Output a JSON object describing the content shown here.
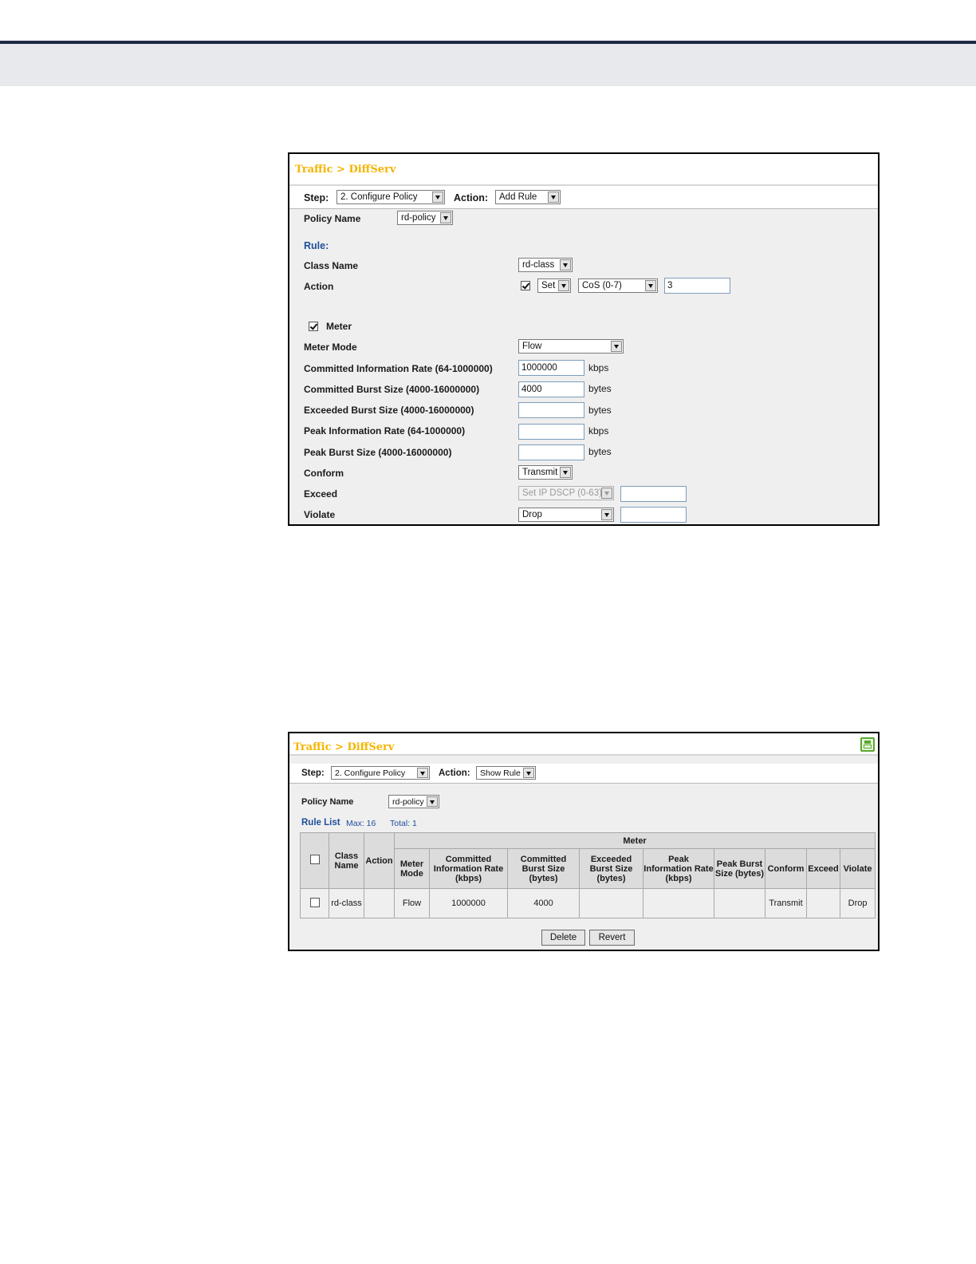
{
  "panel1": {
    "title": "Traffic > DiffServ",
    "step_label": "Step:",
    "step_value": "2. Configure Policy",
    "action_label": "Action:",
    "action_value": "Add Rule",
    "policy_name_label": "Policy Name",
    "policy_name_value": "rd-policy",
    "rule_heading": "Rule:",
    "class_name_label": "Class Name",
    "class_name_value": "rd-class",
    "action_row_label": "Action",
    "action_set_value": "Set",
    "action_type_value": "CoS (0-7)",
    "action_input_value": "3",
    "meter_label": "Meter",
    "meter_mode_label": "Meter Mode",
    "meter_mode_value": "Flow",
    "cir_label": "Committed Information Rate (64-1000000)",
    "cir_value": "1000000",
    "cir_unit": "kbps",
    "cbs_label": "Committed Burst Size (4000-16000000)",
    "cbs_value": "4000",
    "cbs_unit": "bytes",
    "ebs_label": "Exceeded Burst Size (4000-16000000)",
    "ebs_unit": "bytes",
    "pir_label": "Peak Information Rate (64-1000000)",
    "pir_unit": "kbps",
    "pbs_label": "Peak Burst Size (4000-16000000)",
    "pbs_unit": "bytes",
    "conform_label": "Conform",
    "conform_value": "Transmit",
    "exceed_label": "Exceed",
    "exceed_value": "Set IP DSCP (0-63)",
    "violate_label": "Violate",
    "violate_value": "Drop"
  },
  "panel2": {
    "title": "Traffic > DiffServ",
    "step_label": "Step:",
    "step_value": "2. Configure Policy",
    "action_label": "Action:",
    "action_value": "Show Rule",
    "policy_name_label": "Policy Name",
    "policy_name_value": "rd-policy",
    "rule_list_label": "Rule List",
    "max_text": "Max: 16",
    "total_text": "Total: 1",
    "table": {
      "meter_group": "Meter",
      "headers": [
        "Class Name",
        "Action",
        "Meter Mode",
        "Committed Information Rate (kbps)",
        "Committed Burst Size (bytes)",
        "Exceeded Burst Size (bytes)",
        "Peak Information Rate (kbps)",
        "Peak Burst Size (bytes)",
        "Conform",
        "Exceed",
        "Violate"
      ],
      "rows": [
        {
          "class_name": "rd-class",
          "action": "",
          "meter_mode": "Flow",
          "cir": "1000000",
          "cbs": "4000",
          "ebs": "",
          "pir": "",
          "pbs": "",
          "conform": "Transmit",
          "exceed": "",
          "violate": "Drop"
        }
      ]
    },
    "delete_label": "Delete",
    "revert_label": "Revert"
  }
}
